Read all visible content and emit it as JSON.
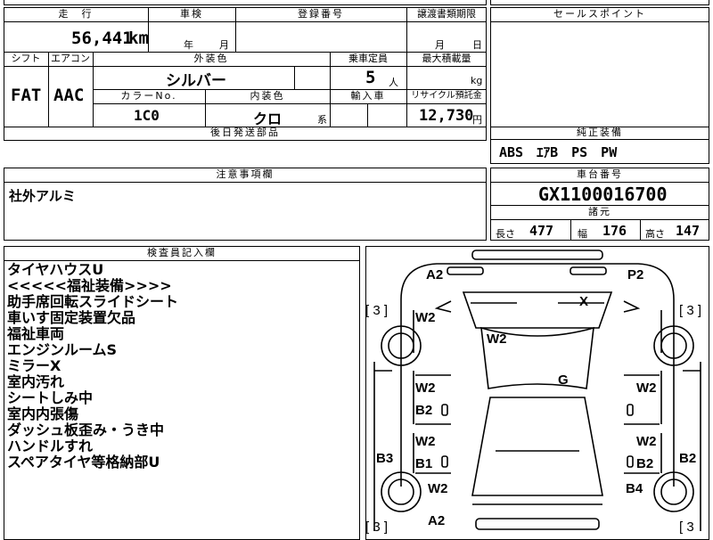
{
  "header": {
    "mileage_label": "走　行",
    "inspection_label": "車検",
    "registration_label": "登録番号",
    "transfer_label": "譲渡書類期限",
    "mileage_value": "56,441",
    "mileage_unit": "km",
    "year_unit": "年",
    "month_unit": "月",
    "transfer_month": "月",
    "transfer_day": "日"
  },
  "specs": {
    "shift_label": "シフト",
    "aircon_label": "エアコン",
    "exterior_label": "外装色",
    "capacity_label": "乗車定員",
    "maxload_label": "最大積載量",
    "shift_value": "FAT",
    "aircon_value": "AAC",
    "exterior_value": "シルバー",
    "capacity_value": "5",
    "capacity_unit": "人",
    "maxload_unit": "kg",
    "colorno_label": "カラーNo.",
    "interior_label": "内装色",
    "import_label": "輸入車",
    "recycle_label": "リサイクル預託金",
    "colorno_value": "1C0",
    "interior_value": "クロ",
    "interior_suffix": "系",
    "recycle_value": "12,730",
    "recycle_unit": "円",
    "later_parts_label": "後日発送部品"
  },
  "sales": {
    "sales_point_label": "セールスポイント",
    "equipment_label": "純正装備",
    "equipment_value": "ABS　ｴｱB　PS　PW"
  },
  "notes": {
    "label": "注意事項欄",
    "value": "社外アルミ"
  },
  "chassis": {
    "label": "車台番号",
    "value": "GX1100016700",
    "dims_label": "諸元",
    "length_label": "長さ",
    "length_value": "477",
    "width_label": "幅",
    "width_value": "176",
    "height_label": "高さ",
    "height_value": "147"
  },
  "inspector": {
    "label": "検査員記入欄",
    "remarks": [
      "タイヤハウスU",
      "<<<<<福祉装備>>>>",
      "助手席回転スライドシート",
      "車いす固定装置欠品",
      "福祉車両",
      "エンジンルームS",
      "ミラーX",
      "室内汚れ",
      "シートしみ中",
      "室内内張傷",
      "ダッシュ板歪み・うき中",
      "ハンドルすれ",
      "スペアタイヤ等格納部U"
    ]
  },
  "diagram": {
    "marks": [
      "A2",
      "P2",
      "X",
      "W2",
      "W2",
      "G",
      "W2",
      "W2",
      "B2",
      "B3",
      "W2",
      "W2",
      "B1",
      "B2",
      "B2",
      "W2",
      "B4",
      "A2"
    ],
    "tire_marks": [
      "[ 3 ]",
      "[ 3 ]",
      "[ 3 ]",
      "[ 3"
    ]
  }
}
